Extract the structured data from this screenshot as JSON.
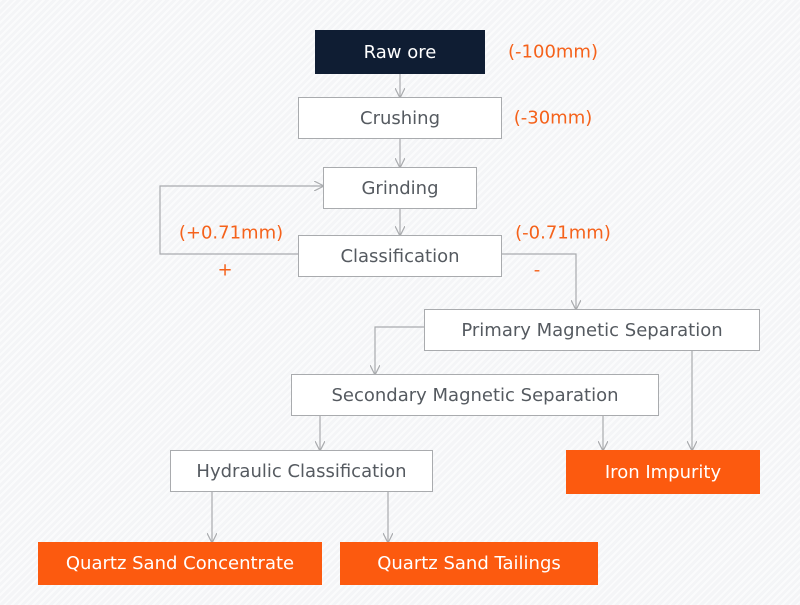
{
  "nodes": {
    "raw_ore": "Raw ore",
    "crushing": "Crushing",
    "grinding": "Grinding",
    "classification": "Classification",
    "primary": "Primary Magnetic Separation",
    "secondary": "Secondary Magnetic Separation",
    "hydraulic": "Hydraulic Classification",
    "iron": "Iron Impurity",
    "concentrate": "Quartz Sand Concentrate",
    "tailings": "Quartz Sand Tailings"
  },
  "labels": {
    "raw_size": "(-100mm)",
    "crush_size": "(-30mm)",
    "oversize": "(+0.71mm)",
    "undersize": "(-0.71mm)",
    "plus": "+",
    "minus": "-"
  },
  "colors": {
    "dark": "#0f1d33",
    "accent": "#fc5a0f",
    "line": "#a9abae"
  }
}
